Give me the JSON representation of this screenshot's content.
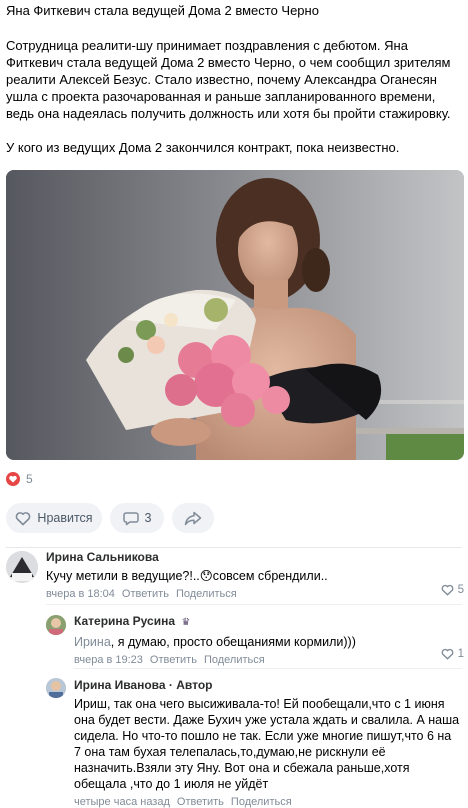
{
  "post": {
    "title": "Яна Фиткевич стала ведущей Дома 2 вместо Черно",
    "paragraph1": "Сотрудница реалити-шу принимает поздравления с дебютом. Яна Фиткевич стала ведущей Дома 2 вместо Черно, о чем сообщил зрителям реалити Алексей Безус. Стало известно, почему Александра Оганесян ушла с проекта разочарованная и раньше запланированного времени, ведь она надеялась получить должность или хотя бы пройти стажировку.",
    "paragraph2": "У кого из ведущих Дома 2 закончился контракт, пока неизвестно.",
    "likes_count": "5",
    "like_button": "Нравится",
    "comments_count": "3"
  },
  "comments": [
    {
      "author": "Ирина Сальникова",
      "text": "Кучу метили в ведущие?!..😯совсем сбрендили..",
      "time": "вчера в 18:04",
      "reply": "Ответить",
      "share": "Поделиться",
      "likes": "5"
    },
    {
      "author": "Катерина Русина",
      "mention": "Ирина",
      "text": ", я думаю, просто обещаниями кормили)))",
      "time": "вчера в 19:23",
      "reply": "Ответить",
      "share": "Поделиться",
      "likes": "1"
    },
    {
      "author": "Ирина Иванова",
      "author_suffix": " · Автор",
      "text": "Ириш, так она чего высиживала-то! Ей пообещали,что с 1 июня она будет вести. Даже Бухич уже устала ждать и свалила. А наша сидела. Но что-то пошло не так. Если уже многие пишут,что 6 на 7 она там бухая телепалась,то,думаю,не рискнули её назначить.Взяли эту Яну. Вот она и сбежала раньше,хотя обещала ,что до 1 июля не уйдёт",
      "time": "четыре часа назад",
      "reply": "Ответить",
      "share": "Поделиться"
    }
  ],
  "colors": {
    "accent": "#2a5885",
    "muted": "#818c99",
    "button_bg": "#f0f2f5",
    "heart": "#e64646"
  }
}
